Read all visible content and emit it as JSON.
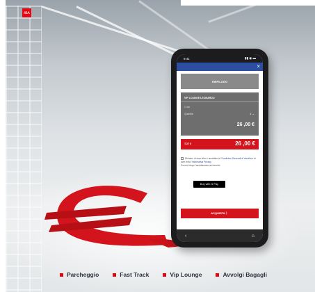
{
  "brand": {
    "logo_text": "SIA",
    "accent": "#e30613",
    "app_blue": "#2c4ea0"
  },
  "phone": {
    "status_time": "9:41",
    "status_icons": "▮▮ ◉ ▬",
    "close_icon": "×",
    "section_title": "RIEPILOGO",
    "card": {
      "title": "VIP LOUNGE LEONARDO",
      "label1": "1 ora",
      "label2": "Quantità",
      "qty": "1 ⌄",
      "price": "26 ,00 €"
    },
    "total_label": "TOT €",
    "total_price": "26 ,00 €",
    "consent_text": "Dichiaro di aver letto e accettato le",
    "consent_link1": "Condizioni Generali di Vendita",
    "consent_mid": "e di aver letto l'",
    "consent_link2": "Informativa Privacy",
    "consent_note": "Procedi dopo l'accettazione dei termini",
    "gpay_label": "Buy with G Pay",
    "pay_label": "ACQUISTA  〉",
    "nav_back": "‹",
    "nav_home": "⌂"
  },
  "legend": [
    {
      "label": "Parcheggio"
    },
    {
      "label": "Fast Track"
    },
    {
      "label": "Vip Lounge"
    },
    {
      "label": "Avvolgi Bagagli"
    }
  ]
}
